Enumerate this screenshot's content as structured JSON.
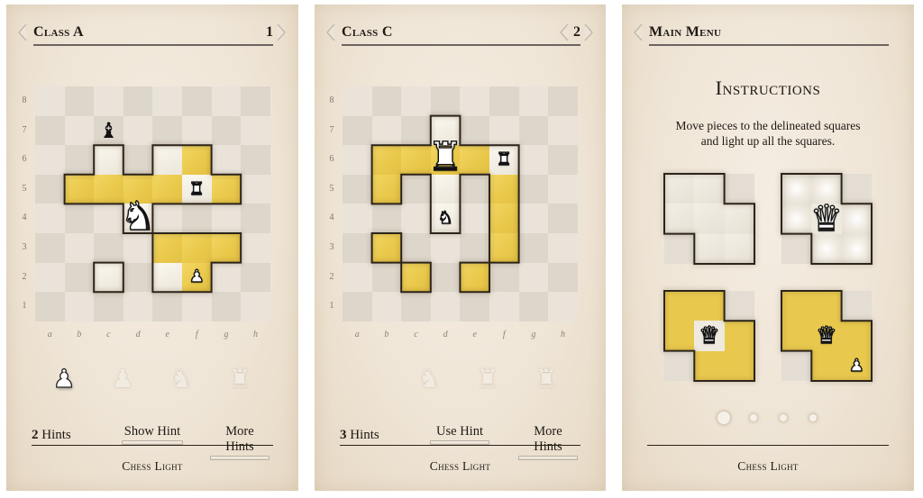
{
  "colors": {
    "yellow": "#e9c84a",
    "highlight_white": "#f6f2ea",
    "outline": "#2c241a",
    "panel_bg": "#efe5d6"
  },
  "files": [
    "a",
    "b",
    "c",
    "d",
    "e",
    "f",
    "g",
    "h"
  ],
  "ranks": [
    "8",
    "7",
    "6",
    "5",
    "4",
    "3",
    "2",
    "1"
  ],
  "screens": [
    {
      "title": "Class A",
      "level": "1",
      "has_prev_level": false,
      "board": {
        "cells": [
          {
            "sq": "c6",
            "state": "white"
          },
          {
            "sq": "e6",
            "state": "white"
          },
          {
            "sq": "f6",
            "state": "yellow"
          },
          {
            "sq": "b5",
            "state": "yellow"
          },
          {
            "sq": "c5",
            "state": "yellow"
          },
          {
            "sq": "d5",
            "state": "yellow"
          },
          {
            "sq": "e5",
            "state": "yellow"
          },
          {
            "sq": "f5",
            "state": "white"
          },
          {
            "sq": "g5",
            "state": "yellow"
          },
          {
            "sq": "d4",
            "state": "white"
          },
          {
            "sq": "e3",
            "state": "yellow"
          },
          {
            "sq": "f3",
            "state": "yellow"
          },
          {
            "sq": "g3",
            "state": "yellow"
          },
          {
            "sq": "c2",
            "state": "white"
          },
          {
            "sq": "e2",
            "state": "white"
          },
          {
            "sq": "f2",
            "state": "yellow"
          }
        ],
        "pieces": [
          {
            "sq": "c7",
            "type": "bishop",
            "color": "black",
            "glyph": "♝",
            "size": "mid"
          },
          {
            "sq": "d4",
            "type": "knight",
            "color": "white",
            "glyph": "♞",
            "size": "big",
            "selected": true
          },
          {
            "sq": "f5",
            "type": "rook",
            "color": "white",
            "glyph": "♜",
            "size": "sm"
          },
          {
            "sq": "f2",
            "type": "pawn",
            "color": "white",
            "glyph": "♟",
            "size": "sm"
          }
        ]
      },
      "tray": [
        {
          "type": "pawn",
          "glyph": "♟",
          "state": "active"
        },
        {
          "type": "pawn",
          "glyph": "♟",
          "state": "used"
        },
        {
          "type": "knight",
          "glyph": "♞",
          "state": "used"
        },
        {
          "type": "rook",
          "glyph": "♜",
          "state": "used"
        }
      ],
      "hints": {
        "count": "2",
        "label": "Hints",
        "primary_button": "Show Hint",
        "secondary_button": "More Hints"
      },
      "footer": "Chess Light"
    },
    {
      "title": "Class C",
      "level": "2",
      "has_prev_level": true,
      "board": {
        "cells": [
          {
            "sq": "d7",
            "state": "white"
          },
          {
            "sq": "b6",
            "state": "yellow"
          },
          {
            "sq": "c6",
            "state": "yellow"
          },
          {
            "sq": "d6",
            "state": "yellow"
          },
          {
            "sq": "e6",
            "state": "yellow"
          },
          {
            "sq": "f6",
            "state": "white"
          },
          {
            "sq": "b5",
            "state": "yellow"
          },
          {
            "sq": "d5",
            "state": "white"
          },
          {
            "sq": "f5",
            "state": "yellow"
          },
          {
            "sq": "d4",
            "state": "white"
          },
          {
            "sq": "f4",
            "state": "yellow"
          },
          {
            "sq": "b3",
            "state": "yellow"
          },
          {
            "sq": "f3",
            "state": "yellow"
          },
          {
            "sq": "c2",
            "state": "yellow"
          },
          {
            "sq": "e2",
            "state": "yellow"
          }
        ],
        "pieces": [
          {
            "sq": "d6",
            "type": "rook",
            "color": "white",
            "glyph": "♜",
            "size": "big",
            "selected": true
          },
          {
            "sq": "f6",
            "type": "rook",
            "color": "white",
            "glyph": "♜",
            "size": "sm"
          },
          {
            "sq": "d4",
            "type": "knight",
            "color": "white",
            "glyph": "♞",
            "size": "sm"
          }
        ]
      },
      "tray": [
        {
          "type": "knight",
          "glyph": "♞",
          "state": "used"
        },
        {
          "type": "rook",
          "glyph": "♜",
          "state": "used"
        },
        {
          "type": "rook",
          "glyph": "♜",
          "state": "used"
        }
      ],
      "hints": {
        "count": "3",
        "label": "Hints",
        "primary_button": "Use Hint",
        "secondary_button": "More Hints"
      },
      "footer": "Chess Light"
    }
  ],
  "instructions": {
    "back_label": "Main Menu",
    "title": "Instructions",
    "text_line1": "Move pieces to the delineated squares",
    "text_line2": "and light up all the squares.",
    "demos": [
      {
        "step": 1,
        "description": "empty outlined shape",
        "cells": [
          "w",
          "w",
          "bg",
          "w",
          "w",
          "w",
          "bg",
          "w",
          "w"
        ],
        "pieces": []
      },
      {
        "step": 2,
        "description": "queen placed, rays lighting",
        "cells": [
          "wl",
          "wl",
          "bg",
          "wl",
          "yw",
          "wl",
          "bg",
          "wl",
          "wl"
        ],
        "pieces": [
          {
            "cell": 4,
            "glyph": "♛",
            "type": "queen",
            "size": "big"
          }
        ]
      },
      {
        "step": 3,
        "description": "squares lit by queen",
        "cells": [
          "y",
          "y",
          "bg",
          "y",
          "yw",
          "y",
          "bg",
          "y",
          "y"
        ],
        "pieces": [
          {
            "cell": 4,
            "glyph": "♛",
            "type": "queen",
            "size": "mid"
          }
        ]
      },
      {
        "step": 4,
        "description": "queen and pawn",
        "cells": [
          "y",
          "y",
          "bg",
          "y",
          "y",
          "y",
          "bg",
          "y",
          "y"
        ],
        "pieces": [
          {
            "cell": 4,
            "glyph": "♛",
            "type": "queen",
            "size": "mid"
          },
          {
            "cell": 8,
            "glyph": "♟",
            "type": "pawn",
            "size": "sm"
          }
        ]
      }
    ],
    "page_dots": {
      "count": 4,
      "active": 0
    },
    "footer": "Chess Light"
  }
}
